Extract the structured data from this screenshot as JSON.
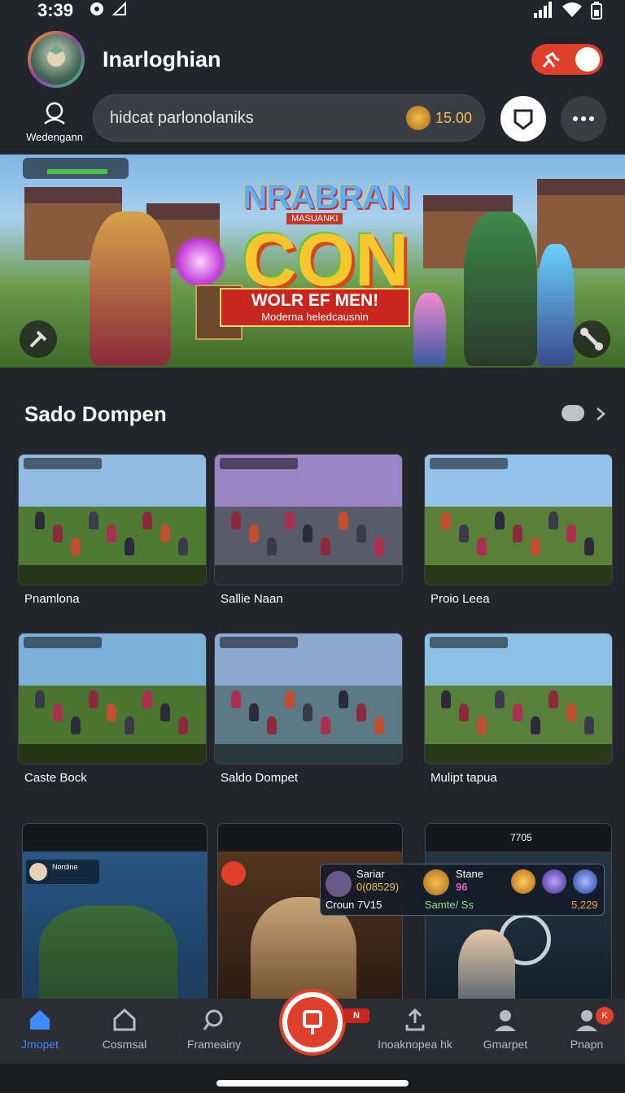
{
  "status_bar": {
    "time": "3:39",
    "icons": [
      "notification-icon",
      "location-icon",
      "signal-icon",
      "wifi-icon",
      "battery-icon"
    ]
  },
  "header": {
    "username": "Inarloghian",
    "toggle_on": true
  },
  "wallet": {
    "label": "Wedengann"
  },
  "search": {
    "placeholder": "hidcat parlonolaniks",
    "balance": "15.00"
  },
  "banner": {
    "logo_top": "NRABRAN",
    "logo_sub": "MASUANKI",
    "logo_big": "CON",
    "ribbon_title": "WOLR EF MEN!",
    "ribbon_subtitle": "Moderna heledcausnin"
  },
  "section": {
    "title": "Sado Dompen"
  },
  "games": [
    {
      "label": "Pnamlona",
      "sky": "#8fbce0",
      "ground": "#4e7a34"
    },
    {
      "label": "Sallie Naan",
      "sky": "#9a86c4",
      "ground": "#5a5a6a"
    },
    {
      "label": "Proio Leea",
      "sky": "#94c2e8",
      "ground": "#5a7f38"
    },
    {
      "label": "Caste Bock",
      "sky": "#7cb0d8",
      "ground": "#4b7530"
    },
    {
      "label": "Saldo Dompet",
      "sky": "#8aa8d0",
      "ground": "#5a7a86"
    },
    {
      "label": "Mulipt tapua",
      "sky": "#8cc0e4",
      "ground": "#58803a"
    }
  ],
  "tooltip": {
    "left_name": "Sariar",
    "left_code": "0(08529)",
    "left_sub": "Croun 7V15",
    "right_name": "Stane",
    "right_value": "96",
    "right_sub": "Samte/ Ss",
    "right_amount": "5,229"
  },
  "tiles": {
    "t1_label": "Nordine",
    "t3_stat": "7705"
  },
  "nav": {
    "items": [
      "Jmopet",
      "Cosmsal",
      "Frameainy",
      "Inoaknopea hk",
      "Gmarpet",
      "Pnapn"
    ],
    "fab_badge": "N",
    "profile_badge": "K"
  },
  "colors": {
    "accent": "#e0402a",
    "active": "#3d8bff",
    "background": "#22252c"
  }
}
